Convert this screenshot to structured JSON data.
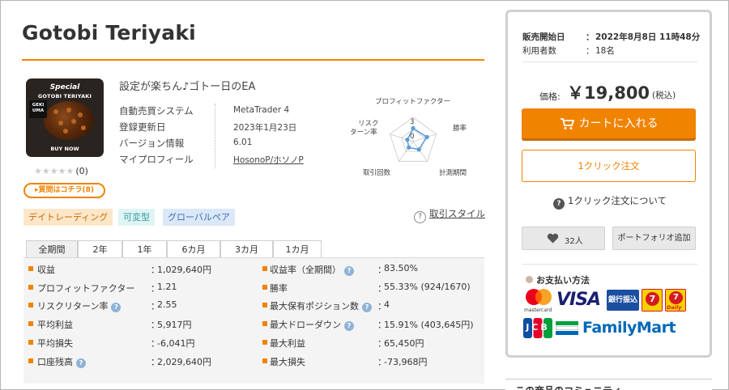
{
  "product": {
    "title": "Gotobi Teriyaki",
    "subtitle": "設定が楽ちん♪ゴトー日のEA",
    "image": {
      "special": "Special",
      "name": "GOTOBI TERIYAKI",
      "geki_line1": "GEKI",
      "geki_line2": "UMA",
      "buy_now": "BUY NOW"
    },
    "rating_stars": "★★★★★",
    "rating_count": "(0)",
    "question_button": "▸質問はコチラ(8)"
  },
  "info": [
    {
      "label": "自動売買システム",
      "value": "MetaTrader 4"
    },
    {
      "label": "登録更新日",
      "value": "2023年1月23日"
    },
    {
      "label": "バージョン情報",
      "value": "6.01"
    },
    {
      "label": "マイプロフィール",
      "value": "HosonoP/ホソノP"
    }
  ],
  "radar": {
    "axes": [
      "プロフィットファクター",
      "勝率",
      "計測期間",
      "取引回数",
      "リスク",
      "ターン率"
    ],
    "scale_labels": [
      "3",
      "0"
    ],
    "values": [
      0.55,
      0.6,
      0.4,
      0.3,
      0.25
    ],
    "color": "#5b9bd5"
  },
  "tags": [
    "デイトレーディング",
    "可変型",
    "グローバルペア"
  ],
  "style_link": "取引スタイル",
  "tabs": [
    "全期間",
    "2年",
    "1年",
    "6カ月",
    "3カ月",
    "1カ月"
  ],
  "stats_left": [
    {
      "label": "収益",
      "value": "1,029,640円",
      "help": false
    },
    {
      "label": "プロフィットファクター",
      "value": "1.21",
      "help": false
    },
    {
      "label": "リスクリターン率",
      "value": "2.55",
      "help": true
    },
    {
      "label": "平均利益",
      "value": "5,917円",
      "help": false
    },
    {
      "label": "平均損失",
      "value": "-6,041円",
      "help": false
    },
    {
      "label": "口座残高",
      "value": "2,029,640円",
      "help": true
    }
  ],
  "stats_right": [
    {
      "label": "収益率（全期間）",
      "value": "83.50%",
      "help": true
    },
    {
      "label": "勝率",
      "value": "55.33% (924/1670)",
      "help": false
    },
    {
      "label": "最大保有ポジション数",
      "value": "4",
      "help": true
    },
    {
      "label": "最大ドローダウン",
      "value": "15.91% (403,645円)",
      "help": true
    },
    {
      "label": "最大利益",
      "value": "65,450円",
      "help": false
    },
    {
      "label": "最大損失",
      "value": "-73,968円",
      "help": false
    }
  ],
  "stats_colon": "：",
  "help_mark": "?",
  "panel": {
    "sale_start_label": "販売開始日",
    "sale_start_value": "2022年8月8日 11時48分",
    "users_label": "利用者数",
    "users_value": "18名",
    "colon": "：",
    "price_label": "価格:",
    "price_value": "￥19,800",
    "price_tax": "(税込)",
    "cart_button": "カートに入れる",
    "oneclick_button": "1クリック注文",
    "oneclick_help": "1クリック注文について",
    "like_count": "32人",
    "portfolio_button": "ポートフォリオ追加",
    "payment_heading": "お支払い方法",
    "payment_logos": {
      "mastercard": "mastercard",
      "visa": "VISA",
      "bank": "銀行振込",
      "daily": "Daily",
      "jcb": "JCB",
      "familymart": "FamilyMart"
    },
    "community": "この商品のコミュニティ"
  },
  "colors": {
    "accent": "#f08300",
    "accent_dark": "#c96b00",
    "stats_bg": "#f4f4f4"
  }
}
